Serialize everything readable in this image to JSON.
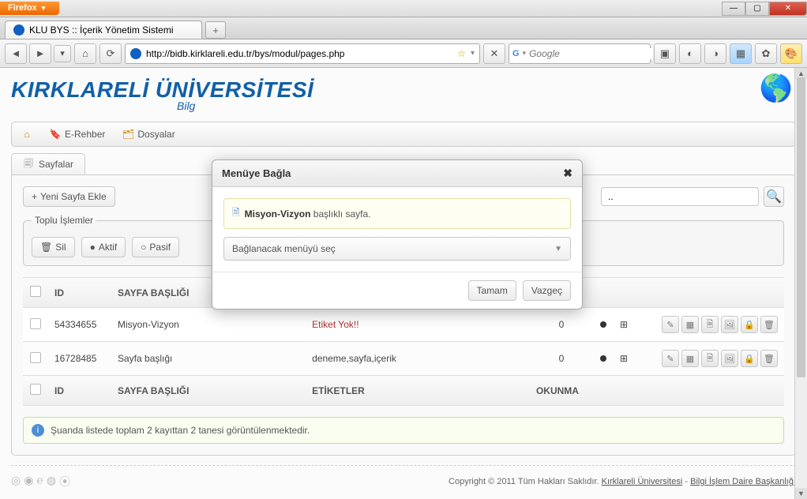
{
  "window": {
    "firefox_label": "Firefox",
    "win_min": "—",
    "win_max": "▢",
    "win_close": "✕"
  },
  "tabstrip": {
    "active_tab_title": "KLU BYS :: İçerik Yönetim Sistemi",
    "newtab_glyph": "+"
  },
  "toolbar": {
    "back": "◄",
    "fwd": "►",
    "hist": "▾",
    "home": "⌂",
    "reload": "⟳",
    "url": "http://bidb.kirklareli.edu.tr/bys/modul/pages.php",
    "star": "☆",
    "dd": "▾",
    "stop": "✕",
    "search_placeholder": "Google",
    "search_go": "🔍"
  },
  "header": {
    "title": "KIRKLARELİ ÜNİVERSİTESİ",
    "subtitle": "Bilg"
  },
  "nav": {
    "home": "",
    "erehber": "E-Rehber",
    "dosyalar": "Dosyalar"
  },
  "page_tab": {
    "label": "Sayfalar"
  },
  "actions": {
    "new_page": "Yeni Sayfa Ekle",
    "search_tail": "..",
    "search_icon": "🔍"
  },
  "bulk": {
    "legend": "Toplu İşlemler",
    "delete": "Sil",
    "active": "Aktif",
    "passive": "Pasif"
  },
  "table": {
    "headers": {
      "id": "ID",
      "title": "SAYFA BAŞLIĞI",
      "tags": "ETİKETLER",
      "reads": "OKUNMA"
    },
    "rows": [
      {
        "id": "54334655",
        "title": "Misyon-Vizyon",
        "tags": "Etiket Yok!!",
        "tags_red": true,
        "reads": "0"
      },
      {
        "id": "16728485",
        "title": "Sayfa başlığı",
        "tags": "deneme,sayfa,içerik",
        "tags_red": false,
        "reads": "0"
      }
    ],
    "row_action_icons": [
      "✎",
      "▦",
      "🗎",
      "🖼",
      "🔒",
      "🗑"
    ],
    "grid_icon": "⊞"
  },
  "info": {
    "text": "Şuanda listede toplam 2 kayıttan 2 tanesi görüntülenmektedir."
  },
  "footer": {
    "copyright": "Copyright © 2011 Tüm Hakları Saklıdır.",
    "link1": "Kırklareli Üniversitesi",
    "sep": " - ",
    "link2": "Bilgi İşlem Daire Başkanlığı"
  },
  "modal": {
    "title": "Menüye Bağla",
    "note_page": "Misyon-Vizyon",
    "note_tail": " başlıklı sayfa.",
    "select_placeholder": "Bağlanacak menüyü seç",
    "ok": "Tamam",
    "cancel": "Vazgeç",
    "close": "✖"
  }
}
